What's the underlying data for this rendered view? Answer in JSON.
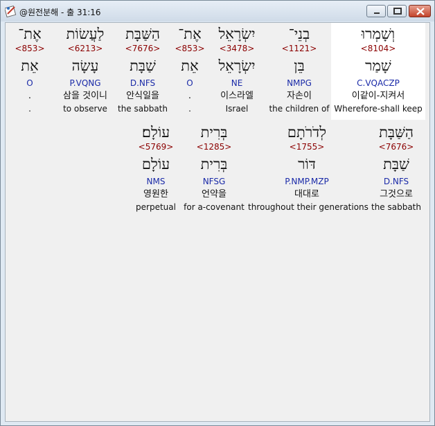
{
  "window": {
    "title": "@원전분해 - 출 31:16"
  },
  "rows": [
    [
      {
        "heb": "וְשָׁמְרוּ",
        "strong": "<8104>",
        "lemma": "שָׁמַר",
        "morph": "C.VQACZP",
        "kor": "이같이-지켜서",
        "eng": "Wherefore-shall keep",
        "highlight": true
      },
      {
        "heb": "בְנֵי־",
        "strong": "<1121>",
        "lemma": "בֵּן",
        "morph": "NMPG",
        "kor": "자손이",
        "eng": "the children of"
      },
      {
        "heb": "יִשְׂרָאֵל",
        "strong": "<3478>",
        "lemma": "יִשְׂרָאֵל",
        "morph": "NE",
        "kor": "이스라엘",
        "eng": "Israel"
      },
      {
        "heb": "אֶת־",
        "strong": "<853>",
        "lemma": "אֵת",
        "morph": "O",
        "kor": ".",
        "eng": "."
      },
      {
        "heb": "הַשַּׁבָּת",
        "strong": "<7676>",
        "lemma": "שַׁבָּת",
        "morph": "D.NFS",
        "kor": "안식일을",
        "eng": "the sabbath"
      },
      {
        "heb": "לַעֲשׂוֹת",
        "strong": "<6213>",
        "lemma": "עָשָׂה",
        "morph": "P.VQNG",
        "kor": "삼을 것이니",
        "eng": "to observe"
      },
      {
        "heb": "אֶת־",
        "strong": "<853>",
        "lemma": "אֵת",
        "morph": "O",
        "kor": ".",
        "eng": "."
      }
    ],
    [
      {
        "heb": "הַשַּׁבָּת",
        "strong": "<7676>",
        "lemma": "שַׁבָּת",
        "morph": "D.NFS",
        "kor": "그것으로",
        "eng": "the sabbath"
      },
      {
        "heb": "לְדֹרֹתָם",
        "strong": "<1755>",
        "lemma": "דּוֹר",
        "morph": "P.NMP.MZP",
        "kor": "대대로",
        "eng": "throughout their generations"
      },
      {
        "heb": "בְּרִית",
        "strong": "<1285>",
        "lemma": "בְּרִית",
        "morph": "NFSG",
        "kor": "언약을",
        "eng": "for a-covenant"
      },
      {
        "heb": "עוֹלָם׃",
        "strong": "<5769>",
        "lemma": "עוֹלָם",
        "morph": "NMS",
        "kor": "영원한",
        "eng": "perpetual"
      }
    ]
  ]
}
